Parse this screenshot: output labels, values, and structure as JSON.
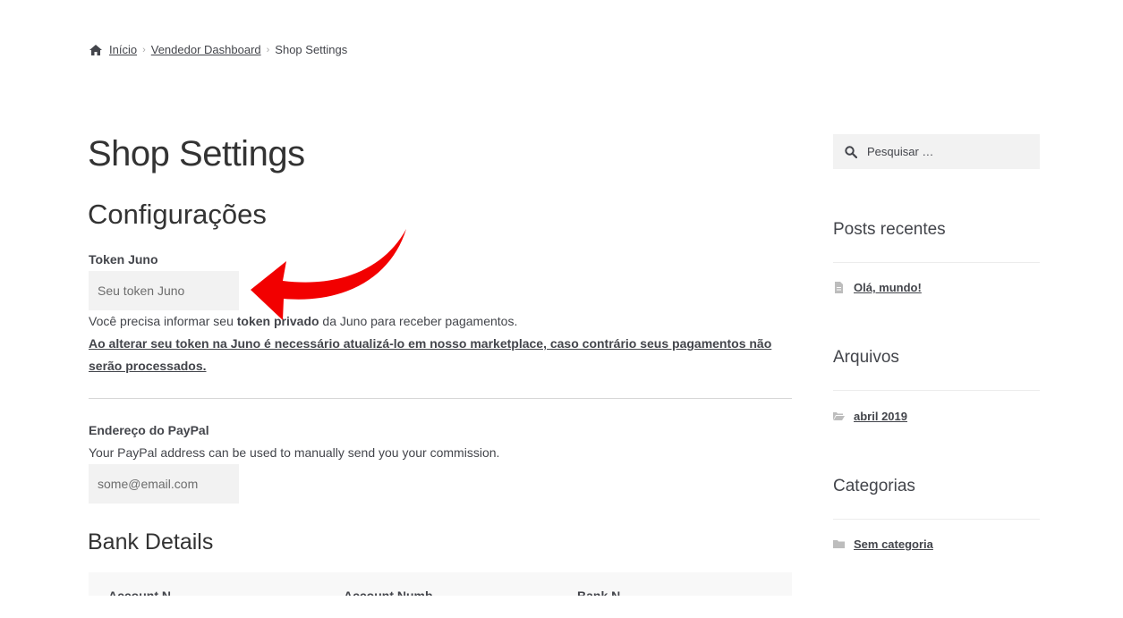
{
  "breadcrumb": {
    "home": "Início",
    "dashboard": "Vendedor Dashboard",
    "current": "Shop Settings"
  },
  "page_title": "Shop Settings",
  "config": {
    "title": "Configurações",
    "token_label": "Token Juno",
    "token_placeholder": "Seu token Juno",
    "help_part1": "Você precisa informar seu ",
    "help_bold": "token privado",
    "help_part2": " da Juno para receber pagamentos.",
    "warning": "Ao alterar seu token na Juno é necessário atualizá-lo em nosso marketplace, caso contrário seus pagamentos não serão processados."
  },
  "paypal": {
    "label": "Endereço do PayPal",
    "help": "Your PayPal address can be used to manually send you your commission.",
    "placeholder": "some@email.com"
  },
  "bank": {
    "title": "Bank Details",
    "columns": [
      "Account N",
      "Account Numb",
      "Bank N"
    ]
  },
  "sidebar": {
    "search_placeholder": "Pesquisar …",
    "recent_posts": {
      "title": "Posts recentes",
      "items": [
        "Olá, mundo!"
      ]
    },
    "archives": {
      "title": "Arquivos",
      "items": [
        "abril 2019"
      ]
    },
    "categories": {
      "title": "Categorias",
      "items": [
        "Sem categoria"
      ]
    }
  },
  "colors": {
    "arrow": "#f20000",
    "text": "#43454b",
    "input_bg": "#f2f2f2"
  },
  "icons": [
    "home-icon",
    "search-icon",
    "document-icon",
    "folder-open-icon",
    "folder-icon"
  ]
}
